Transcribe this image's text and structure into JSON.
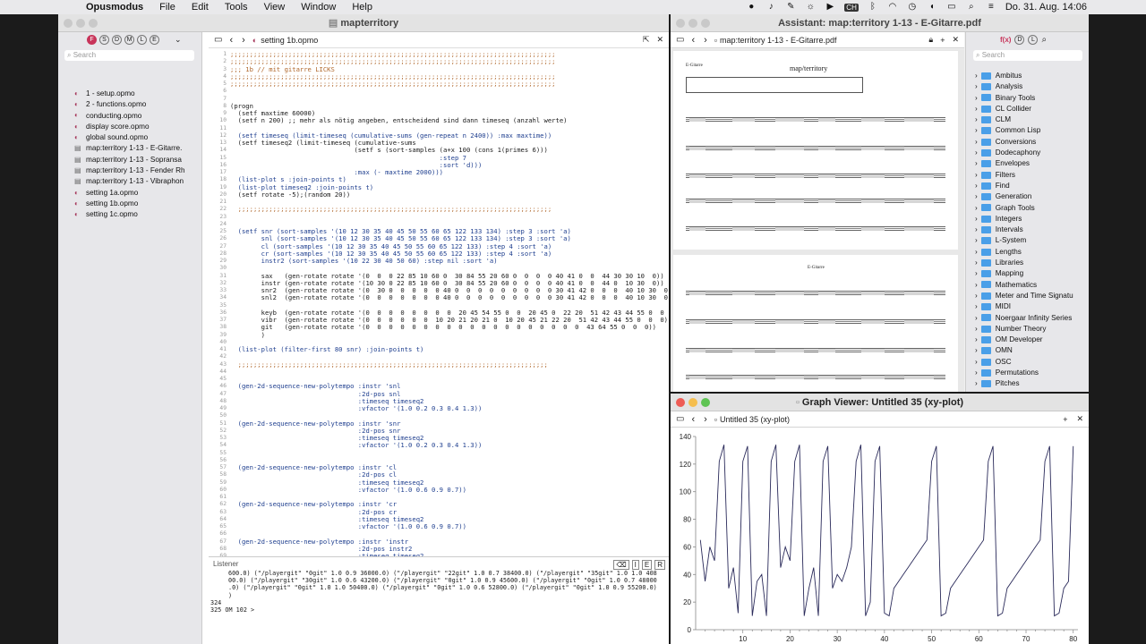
{
  "menubar": {
    "app": "Opusmodus",
    "items": [
      "File",
      "Edit",
      "Tools",
      "View",
      "Window",
      "Help"
    ],
    "input_source": "CH",
    "clock": "Do. 31. Aug.  14:06"
  },
  "main_window": {
    "title": "mapterritory",
    "file_tab": "setting 1b.opmo",
    "navigator": {
      "search_placeholder": "Search",
      "filter_letters": [
        "F",
        "S",
        "D",
        "M",
        "L",
        "E"
      ],
      "files": [
        "1 - setup.opmo",
        "2 - functions.opmo",
        "conducting.opmo",
        "display score.opmo",
        "global sound.opmo",
        "map:territory 1-13  - E-Gitarre.",
        "map:territory 1-13  - Sopransa",
        "map:territory 1-13  - Fender Rh",
        "map:territory 1-13  - Vibraphon",
        "setting 1a.opmo",
        "setting 1b.opmo",
        "setting 1c.opmo"
      ]
    },
    "editor": {
      "lines": [
        {
          "n": "1",
          "t": ";;;;;;;;;;;;;;;;;;;;;;;;;;;;;;;;;;;;;;;;;;;;;;;;;;;;;;;;;;;;;;;;;;;;;;;;;;;;;;;;;;;;",
          "c": "cm"
        },
        {
          "n": "2",
          "t": ";;;;;;;;;;;;;;;;;;;;;;;;;;;;;;;;;;;;;;;;;;;;;;;;;;;;;;;;;;;;;;;;;;;;;;;;;;;;;;;;;;;;",
          "c": "cm"
        },
        {
          "n": "3",
          "t": ";;; 1b // mit gitarre LICKS",
          "c": "cm"
        },
        {
          "n": "4",
          "t": ";;;;;;;;;;;;;;;;;;;;;;;;;;;;;;;;;;;;;;;;;;;;;;;;;;;;;;;;;;;;;;;;;;;;;;;;;;;;;;;;;;;;",
          "c": "cm"
        },
        {
          "n": "5",
          "t": ";;;;;;;;;;;;;;;;;;;;;;;;;;;;;;;;;;;;;;;;;;;;;;;;;;;;;;;;;;;;;;;;;;;;;;;;;;;;;;;;;;;;",
          "c": "cm"
        },
        {
          "n": "6",
          "t": "",
          "c": ""
        },
        {
          "n": "7",
          "t": "",
          "c": ""
        },
        {
          "n": "8",
          "t": "(progn",
          "c": ""
        },
        {
          "n": "9",
          "t": "  (setf maxtime 60000)",
          "c": ""
        },
        {
          "n": "10",
          "t": "  (setf n 200) ;; mehr als nötig angeben, entscheidend sind dann timeseq (anzahl werte)",
          "c": ""
        },
        {
          "n": "11",
          "t": "",
          "c": ""
        },
        {
          "n": "12",
          "t": "  (setf timeseq (limit-timeseq (cumulative-sums (gen-repeat n 2400)) :max maxtime))",
          "c": ""
        },
        {
          "n": "13",
          "t": "  (setf timeseq2 (limit-timeseq (cumulative-sums",
          "c": ""
        },
        {
          "n": "14",
          "t": "                                (setf s (sort-samples (a+x 100 (cons 1(primes 6)))",
          "c": ""
        },
        {
          "n": "15",
          "t": "                                                      :step 7",
          "c": ""
        },
        {
          "n": "16",
          "t": "                                                      :sort 'd)))",
          "c": ""
        },
        {
          "n": "17",
          "t": "                                :max (- maxtime 2000)))",
          "c": ""
        },
        {
          "n": "18",
          "t": "  (list-plot s :join-points t)",
          "c": ""
        },
        {
          "n": "19",
          "t": "  (list-plot timeseq2 :join-points t)",
          "c": ""
        },
        {
          "n": "20",
          "t": "  (setf rotate -5);(random 20))",
          "c": ""
        },
        {
          "n": "21",
          "t": "",
          "c": ""
        },
        {
          "n": "22",
          "t": "  ;;;;;;;;;;;;;;;;;;;;;;;;;;;;;;;;;;;;;;;;;;;;;;;;;;;;;;;;;;;;;;;;;;;;;;;;;;;;;;;;;",
          "c": "cm"
        },
        {
          "n": "23",
          "t": "",
          "c": ""
        },
        {
          "n": "24",
          "t": "",
          "c": ""
        },
        {
          "n": "25",
          "t": "  (setf snr (sort-samples '(10 12 30 35 40 45 50 55 60 65 122 133 134) :step 3 :sort 'a)",
          "c": ""
        },
        {
          "n": "26",
          "t": "        snl (sort-samples '(10 12 30 35 40 45 50 55 60 65 122 133 134) :step 3 :sort 'a)",
          "c": ""
        },
        {
          "n": "27",
          "t": "        cl (sort-samples '(10 12 30 35 40 45 50 55 60 65 122 133) :step 4 :sort 'a)",
          "c": ""
        },
        {
          "n": "28",
          "t": "        cr (sort-samples '(10 12 30 35 40 45 50 55 60 65 122 133) :step 4 :sort 'a)",
          "c": ""
        },
        {
          "n": "29",
          "t": "        instr2 (sort-samples '(10 22 30 40 50 60) :step nil :sort 'a)",
          "c": ""
        },
        {
          "n": "30",
          "t": "",
          "c": ""
        },
        {
          "n": "31",
          "t": "        sax   (gen-rotate rotate '(0  0  0 22 85 10 60 0  30 84 55 20 60 0  0  0  0 40 41 0  0  44 30 30 10  0))",
          "c": ""
        },
        {
          "n": "32",
          "t": "        instr (gen-rotate rotate '(10 30 0 22 85 10 60 0  30 84 55 20 60 0  0  0  0 40 41 0  0  44 0  10 30  0))",
          "c": ""
        },
        {
          "n": "33",
          "t": "        snr2  (gen-rotate rotate '(0  30 0  0  0  0  0 40 0  0  0  0  0  0  0  0  0 30 41 42 0  0  0  40 10 30  0))",
          "c": ""
        },
        {
          "n": "34",
          "t": "        snl2  (gen-rotate rotate '(0  0  0  0  0  0  0 40 0  0  0  0  0  0  0  0  0 30 41 42 0  0  0  40 10 30  0))",
          "c": ""
        },
        {
          "n": "35",
          "t": "",
          "c": ""
        },
        {
          "n": "36",
          "t": "        keyb  (gen-rotate rotate '(0  0  0  0  0  0  0  0  20 45 54 55 0  0  20 45 0  22 20  51 42 43 44 55 0  0  0))",
          "c": ""
        },
        {
          "n": "37",
          "t": "        vibr  (gen-rotate rotate '(0  0  0  0  0  0  10 20 21 20 21 0  10 20 45 21 22 20  51 42 43 44 55 0  0  0))",
          "c": ""
        },
        {
          "n": "38",
          "t": "        git   (gen-rotate rotate '(0  0  0  0  0  0  0  0  0  0  0  0  0  0  0  0  0  0  0  43 64 55 0  0  0))",
          "c": ""
        },
        {
          "n": "39",
          "t": "        )",
          "c": ""
        },
        {
          "n": "40",
          "t": "",
          "c": ""
        },
        {
          "n": "41",
          "t": "  (list-plot (filter-first 80 snr) :join-points t)",
          "c": ""
        },
        {
          "n": "42",
          "t": "",
          "c": ""
        },
        {
          "n": "43",
          "t": "  ;;;;;;;;;;;;;;;;;;;;;;;;;;;;;;;;;;;;;;;;;;;;;;;;;;;;;;;;;;;;;;;;;;;;;;;;;;;;;;;;",
          "c": "cm"
        },
        {
          "n": "44",
          "t": "",
          "c": ""
        },
        {
          "n": "45",
          "t": "",
          "c": ""
        },
        {
          "n": "46",
          "t": "  (gen-2d-sequence-new-polytempo :instr 'snl",
          "c": ""
        },
        {
          "n": "47",
          "t": "                                 :2d-pos snl",
          "c": ""
        },
        {
          "n": "48",
          "t": "                                 :timeseq timeseq2",
          "c": ""
        },
        {
          "n": "49",
          "t": "                                 :vfactor '(1.0 0.2 0.3 0.4 1.3))",
          "c": ""
        },
        {
          "n": "50",
          "t": "",
          "c": ""
        },
        {
          "n": "51",
          "t": "  (gen-2d-sequence-new-polytempo :instr 'snr",
          "c": ""
        },
        {
          "n": "52",
          "t": "                                 :2d-pos snr",
          "c": ""
        },
        {
          "n": "53",
          "t": "                                 :timeseq timeseq2",
          "c": ""
        },
        {
          "n": "54",
          "t": "                                 :vfactor '(1.0 0.2 0.3 0.4 1.3))",
          "c": ""
        },
        {
          "n": "55",
          "t": "",
          "c": ""
        },
        {
          "n": "56",
          "t": "",
          "c": ""
        },
        {
          "n": "57",
          "t": "  (gen-2d-sequence-new-polytempo :instr 'cl",
          "c": ""
        },
        {
          "n": "58",
          "t": "                                 :2d-pos cl",
          "c": ""
        },
        {
          "n": "59",
          "t": "                                 :timeseq timeseq2",
          "c": ""
        },
        {
          "n": "60",
          "t": "                                 :vfactor '(1.0 0.6 0.9 0.7))",
          "c": ""
        },
        {
          "n": "61",
          "t": "",
          "c": ""
        },
        {
          "n": "62",
          "t": "  (gen-2d-sequence-new-polytempo :instr 'cr",
          "c": ""
        },
        {
          "n": "63",
          "t": "                                 :2d-pos cr",
          "c": ""
        },
        {
          "n": "64",
          "t": "                                 :timeseq timeseq2",
          "c": ""
        },
        {
          "n": "65",
          "t": "                                 :vfactor '(1.0 0.6 0.9 0.7))",
          "c": ""
        },
        {
          "n": "66",
          "t": "",
          "c": ""
        },
        {
          "n": "67",
          "t": "  (gen-2d-sequence-new-polytempo :instr 'instr",
          "c": ""
        },
        {
          "n": "68",
          "t": "                                 :2d-pos instr2",
          "c": ""
        },
        {
          "n": "69",
          "t": "                                 :timeseq timeseq2",
          "c": ""
        },
        {
          "n": "70",
          "t": "                                 :vfactor '(1.0 0.6 0.9 0.7))",
          "c": ""
        },
        {
          "n": "71",
          "t": "",
          "c": ""
        },
        {
          "n": "72",
          "t": "  ;;;;;",
          "c": "cm"
        },
        {
          "n": "73",
          "t": "",
          "c": ""
        },
        {
          "n": "74",
          "t": "",
          "c": ""
        },
        {
          "n": "75",
          "t": "  (gen-2d-sequence-new-polytempo :instr 'snl",
          "c": ""
        }
      ]
    },
    "listener": {
      "title": "Listener",
      "lines": [
        "600.0) (\"/playergit\" \"0git\" 1.0 0.9 36000.0) (\"/playergit\" \"22git\" 1.0 0.7 38400.0) (\"/playergit\" \"35git\" 1.0 1.0 408",
        "00.0) (\"/playergit\" \"30git\" 1.0 0.6 43200.0) (\"/playergit\" \"0git\" 1.0 0.9 45600.0) (\"/playergit\" \"0git\" 1.0 0.7 48000",
        ".0) (\"/playergit\" \"0git\" 1.0 1.0 50400.0) (\"/playergit\" \"0git\" 1.0 0.6 52800.0) (\"/playergit\" \"0git\" 1.0 0.9 55200.0)",
        ")",
        "324",
        "325 OM 102 >"
      ]
    }
  },
  "assistant_window": {
    "title": "Assistant: map:territory 1-13  - E-Gitarre.pdf",
    "doc_tab": "map:territory 1-13  - E-Gitarre.pdf",
    "score": {
      "instrument": "E-Gitarre",
      "title": "map/territory",
      "instrument2": "E-Gitarre"
    },
    "library": {
      "search_placeholder": "Search",
      "filter_letters": [
        "f(x)",
        "D",
        "L"
      ],
      "items": [
        "Ambitus",
        "Analysis",
        "Binary Tools",
        "CL Collider",
        "CLM",
        "Common Lisp",
        "Conversions",
        "Dodecaphony",
        "Envelopes",
        "Filters",
        "Find",
        "Generation",
        "Graph Tools",
        "Integers",
        "Intervals",
        "L-System",
        "Lengths",
        "Libraries",
        "Mapping",
        "Mathematics",
        "Meter and Time Signatu",
        "MIDI",
        "Noergaar Infinity Series",
        "Number Theory",
        "OM Developer",
        "OMN",
        "OSC",
        "Permutations",
        "Pitches"
      ]
    }
  },
  "graph_window": {
    "title": "Graph Viewer: Untitled 35 (xy-plot)",
    "tab": "Untitled 35 (xy-plot)"
  },
  "chart_data": {
    "type": "line",
    "title": "",
    "xlabel": "",
    "ylabel": "",
    "xlim": [
      0,
      81
    ],
    "ylim": [
      0,
      140
    ],
    "xticks": [
      10,
      20,
      30,
      40,
      50,
      60,
      70,
      80
    ],
    "yticks": [
      0,
      20,
      40,
      60,
      80,
      100,
      120,
      140
    ],
    "color": "#2a2a5a",
    "series": [
      {
        "x": [
          1,
          2,
          3,
          4,
          5,
          6,
          7,
          8,
          9,
          10,
          11,
          12,
          13,
          14,
          15,
          16,
          17,
          18,
          19,
          20,
          21,
          22,
          23,
          24,
          25,
          26,
          27,
          28,
          29,
          30,
          31,
          32,
          33,
          34,
          35,
          36,
          37,
          38,
          39,
          40,
          41,
          42,
          43,
          44,
          45,
          46,
          47,
          48,
          49,
          50,
          51,
          52,
          53,
          54,
          55,
          56,
          57,
          58,
          59,
          60,
          61,
          62,
          63,
          64,
          65,
          66,
          67,
          68,
          69,
          70,
          71,
          72,
          73,
          74,
          75,
          76,
          77,
          78,
          79,
          80
        ],
        "y": [
          65,
          35,
          60,
          50,
          122,
          134,
          30,
          45,
          12,
          122,
          133,
          10,
          35,
          40,
          10,
          122,
          134,
          45,
          60,
          50,
          122,
          134,
          10,
          30,
          45,
          10,
          122,
          133,
          30,
          40,
          35,
          45,
          60,
          122,
          134,
          10,
          20,
          122,
          133,
          12,
          10,
          30,
          35,
          40,
          45,
          50,
          55,
          60,
          65,
          122,
          133,
          10,
          12,
          30,
          35,
          40,
          45,
          50,
          55,
          60,
          65,
          122,
          133,
          10,
          12,
          30,
          35,
          40,
          45,
          50,
          55,
          60,
          65,
          122,
          133,
          10,
          12,
          30,
          35,
          133
        ]
      }
    ]
  }
}
